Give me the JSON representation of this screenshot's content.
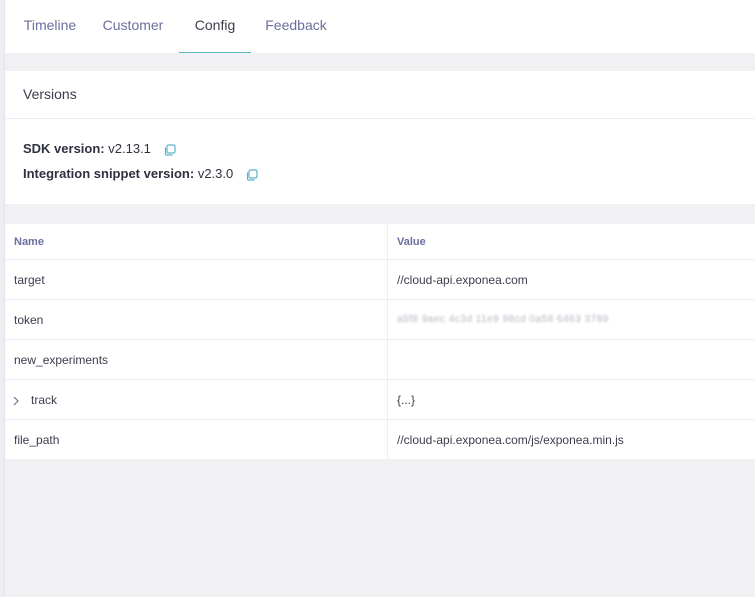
{
  "tabs": [
    {
      "label": "Timeline",
      "active": false
    },
    {
      "label": "Customer",
      "active": false
    },
    {
      "label": "Config",
      "active": true
    },
    {
      "label": "Feedback",
      "active": false
    }
  ],
  "versions": {
    "header": "Versions",
    "sdk_label": "SDK version:",
    "sdk_value": "v2.13.1",
    "snippet_label": "Integration snippet version:",
    "snippet_value": "v2.3.0"
  },
  "config_table": {
    "columns": [
      "Name",
      "Value"
    ],
    "rows": [
      {
        "name": "target",
        "value": "//cloud-api.exponea.com"
      },
      {
        "name": "token",
        "value": "a5f8 9aec 4c3d 11e9 98cd 0a58 6463 3789"
      },
      {
        "name": "new_experiments",
        "value": ""
      },
      {
        "name": "track",
        "value": "{...}"
      },
      {
        "name": "file_path",
        "value": "//cloud-api.exponea.com/js/exponea.min.js"
      }
    ]
  },
  "colors": {
    "accent": "#5bb5c7",
    "tab_text": "#6c6e9e",
    "background": "#f1f1f4"
  }
}
